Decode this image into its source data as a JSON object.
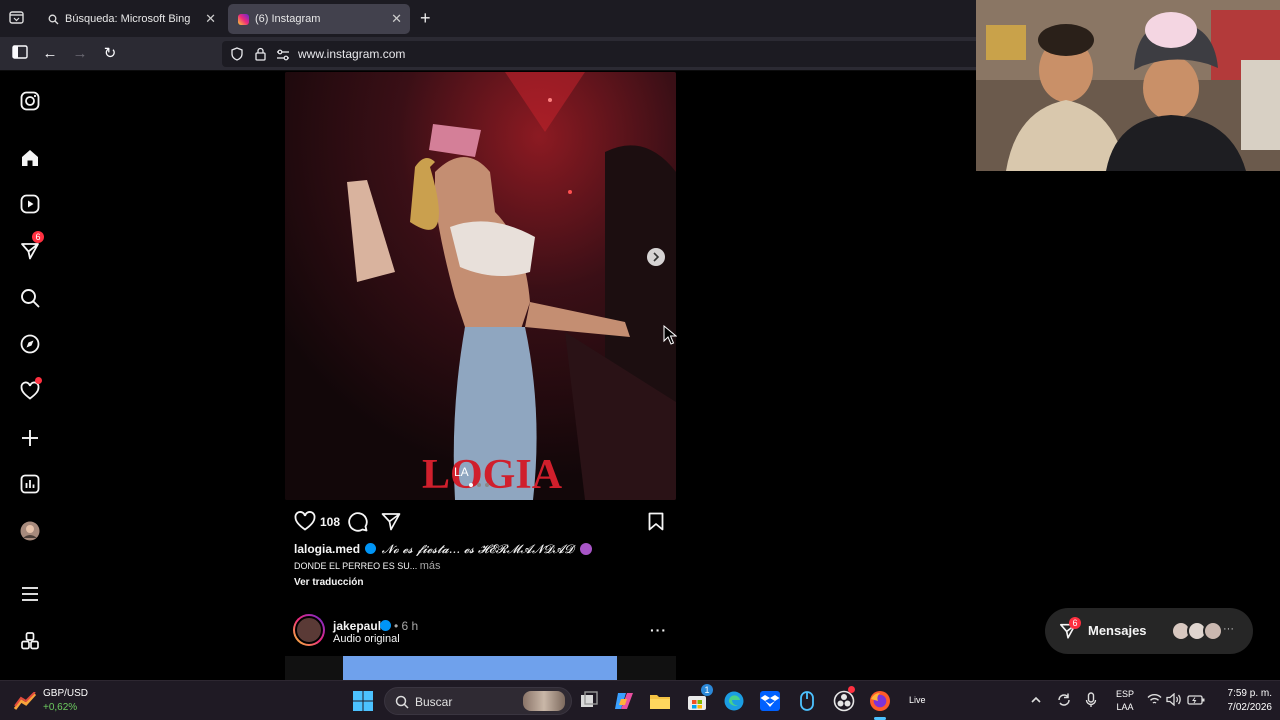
{
  "browser": {
    "tabs": [
      {
        "label": "Búsqueda: Microsoft Bing"
      },
      {
        "label": "(6) Instagram"
      }
    ],
    "url": "www.instagram.com"
  },
  "sidebar": {
    "notifications_badge": "6"
  },
  "post": {
    "image_brand": "LOGIA",
    "image_brand_small": "LA",
    "likes": "108",
    "username": "lalogia.med",
    "caption": "𝓝𝓸 𝓮𝓼 𝓯𝓲𝓮𝓼𝓽𝓪... 𝓮𝓼 𝓗𝓔𝓡𝓜𝓐𝓝𝓓𝓐𝓓",
    "caption_line2": "DONDE EL PERREO ES SU...",
    "more": "más",
    "translate": "Ver traducción"
  },
  "next_post": {
    "username": "jakepaul",
    "time": "• 6 h",
    "audio": "Audio original"
  },
  "messages": {
    "label": "Mensajes",
    "badge": "6"
  },
  "taskbar": {
    "ticker_symbol": "GBP/USD",
    "ticker_change": "+0,62%",
    "search_placeholder": "Buscar",
    "store_badge": "1",
    "live_label": "Live",
    "lang_1": "ESP",
    "lang_2": "LAA",
    "time": "7:59 p. m.",
    "date": "7/02/2026"
  },
  "colors": {
    "badge_red": "#ff3040",
    "ticker_up": "#6ccb5f",
    "accent_blue": "#0095f6"
  }
}
